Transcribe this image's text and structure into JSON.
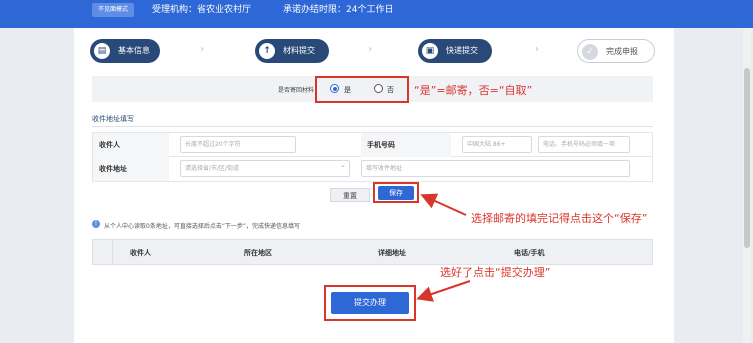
{
  "header": {
    "mode_tag": "不见面模式",
    "agency": "受理机构：省农业农村厅",
    "deadline": "承诺办结时限：24个工作日"
  },
  "steps": [
    {
      "label": "基本信息",
      "icon": "clipboard-icon"
    },
    {
      "label": "材料提交",
      "icon": "upload-icon"
    },
    {
      "label": "快递提交",
      "icon": "truck-icon"
    },
    {
      "label": "完成申报",
      "icon": "check-icon"
    }
  ],
  "return_option": {
    "label": "是否寄回材料",
    "yes": "是",
    "no": "否",
    "selected": "是"
  },
  "annotations": {
    "radio_note": "“是”=邮寄，否=“自取”",
    "save_note": "选择邮寄的填完记得点击这个“保存”",
    "submit_note": "选好了点击“提交办理”"
  },
  "form": {
    "section_title": "收件地址填写",
    "recipient_label": "收件人",
    "recipient_placeholder": "长度不超过20个字符",
    "phone_label": "手机号码",
    "country_code": "中国大陆 86+",
    "phone_placeholder": "电话、手机号码必须填一项",
    "address_label": "收件地址",
    "region_placeholder": "请选择省/市/区/街道",
    "detail_placeholder": "填写收件地址",
    "reset_label": "重置",
    "save_label": "保存"
  },
  "info_text": "从个人中心读取0条地址，可直接选择后点击“下一步”，完成快递信息填写",
  "table": {
    "columns": [
      "收件人",
      "所在地区",
      "详细地址",
      "电话/手机"
    ]
  },
  "submit_label": "提交办理",
  "colors": {
    "primary": "#2e67d6",
    "step_done": "#294a78",
    "annotation": "#d9362b"
  }
}
